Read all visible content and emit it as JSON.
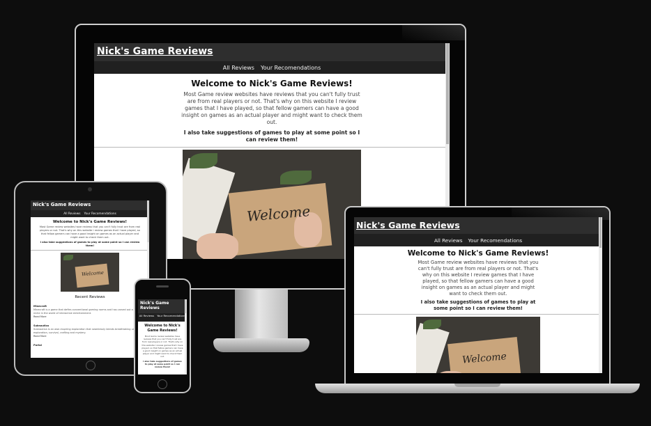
{
  "site": {
    "title": "Nick's Game Reviews",
    "nav": [
      "All Reviews",
      "Your Recomendations"
    ],
    "welcome": "Welcome to Nick's Game Reviews!",
    "intro": "Most Game review websites have reviews that you can't fully trust are from real players or not. That's why on this website I review games that I have played, so that fellow gamers can have a good insight on games as an actual player and might want to check them out.",
    "suggest": "I also take suggestions of games to play at some point so I can review them!",
    "hero_script": "Welcome"
  },
  "tablet_extra": {
    "recent_heading": "Recent Reviews",
    "reviews": [
      {
        "title": "Minecraft",
        "text": "Minecraft is a game that defies conventional gaming norms and has carved out a unique niche in the world of interactive entertainment.",
        "link": "Read More"
      },
      {
        "title": "Subnautica",
        "text": "Subnautica is an awe-inspiring exploration that seamlessly blends breathtaking underwater exploration, survival, crafting and mystery.",
        "link": "Read More"
      },
      {
        "title": "Portal",
        "text": "",
        "link": ""
      }
    ]
  },
  "colors": {
    "header": "#2e2e2e",
    "nav": "#202020",
    "background": "#0d0d0d"
  }
}
